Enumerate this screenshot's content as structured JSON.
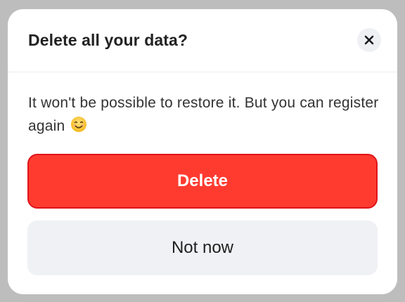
{
  "dialog": {
    "title": "Delete all your data?",
    "message": "It won't be possible to restore it. But you can register again",
    "emoji": "smiling-face-emoji",
    "close_icon": "close-icon",
    "delete_label": "Delete",
    "cancel_label": "Not now"
  },
  "colors": {
    "delete_bg": "#ff3b30",
    "delete_border": "#e0141a",
    "cancel_bg": "#eff1f5",
    "close_bg": "#eef0f3"
  }
}
